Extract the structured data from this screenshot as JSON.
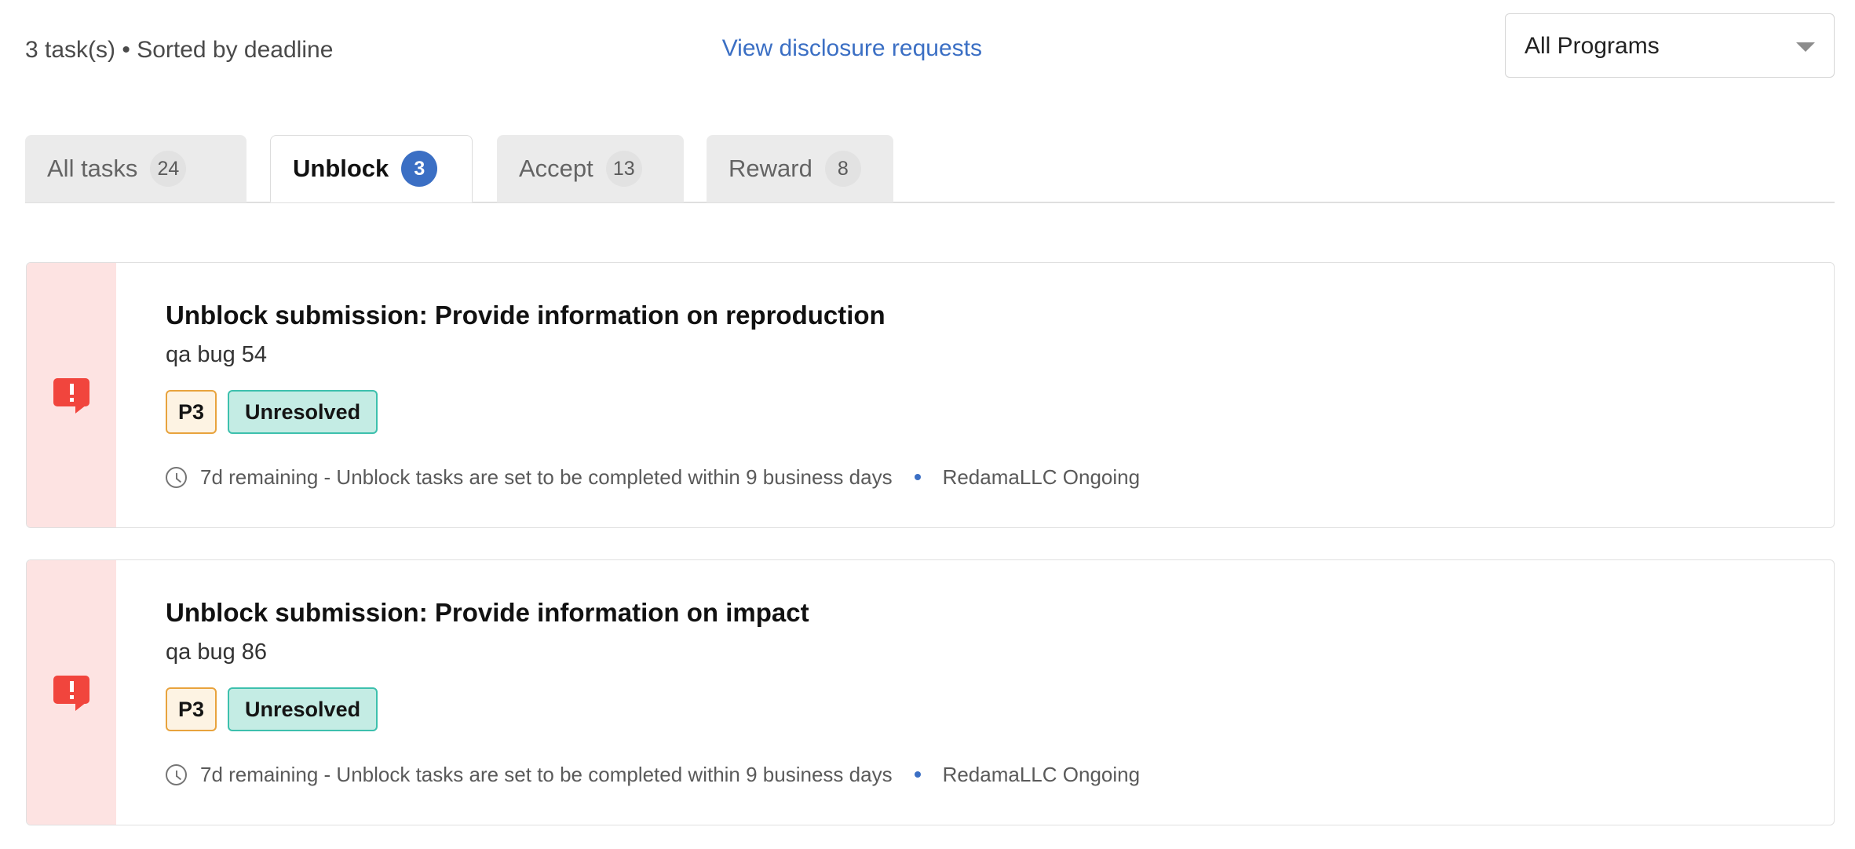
{
  "header": {
    "summary": "3 task(s) • Sorted by deadline",
    "disclosure_link": "View disclosure requests",
    "program_filter": {
      "value": "All Programs",
      "options": [
        "All Programs"
      ]
    }
  },
  "tabs": [
    {
      "label": "All tasks",
      "count": "24",
      "active": false
    },
    {
      "label": "Unblock",
      "count": "3",
      "active": true
    },
    {
      "label": "Accept",
      "count": "13",
      "active": false
    },
    {
      "label": "Reward",
      "count": "8",
      "active": false
    }
  ],
  "tasks": [
    {
      "title": "Unblock submission: Provide information on reproduction",
      "subtitle": "qa bug 54",
      "priority": "P3",
      "state": "Unresolved",
      "deadline": "7d remaining - Unblock tasks are set to be completed within 9 business days",
      "program": "RedamaLLC Ongoing",
      "alert_icon": "alert-comment-icon"
    },
    {
      "title": "Unblock submission: Provide information on impact",
      "subtitle": "qa bug 86",
      "priority": "P3",
      "state": "Unresolved",
      "deadline": "7d remaining - Unblock tasks are set to be completed within 9 business days",
      "program": "RedamaLLC Ongoing",
      "alert_icon": "alert-comment-icon"
    }
  ],
  "colors": {
    "accent_blue": "#3b6fc4",
    "alert_red": "#f1453d",
    "alert_bg": "#fde3e2",
    "priority_bg": "#fdf3e3",
    "priority_border": "#e8a33d",
    "state_bg": "#c4ece4",
    "state_border": "#3dc0ad",
    "tab_inactive_bg": "#ebebeb"
  }
}
